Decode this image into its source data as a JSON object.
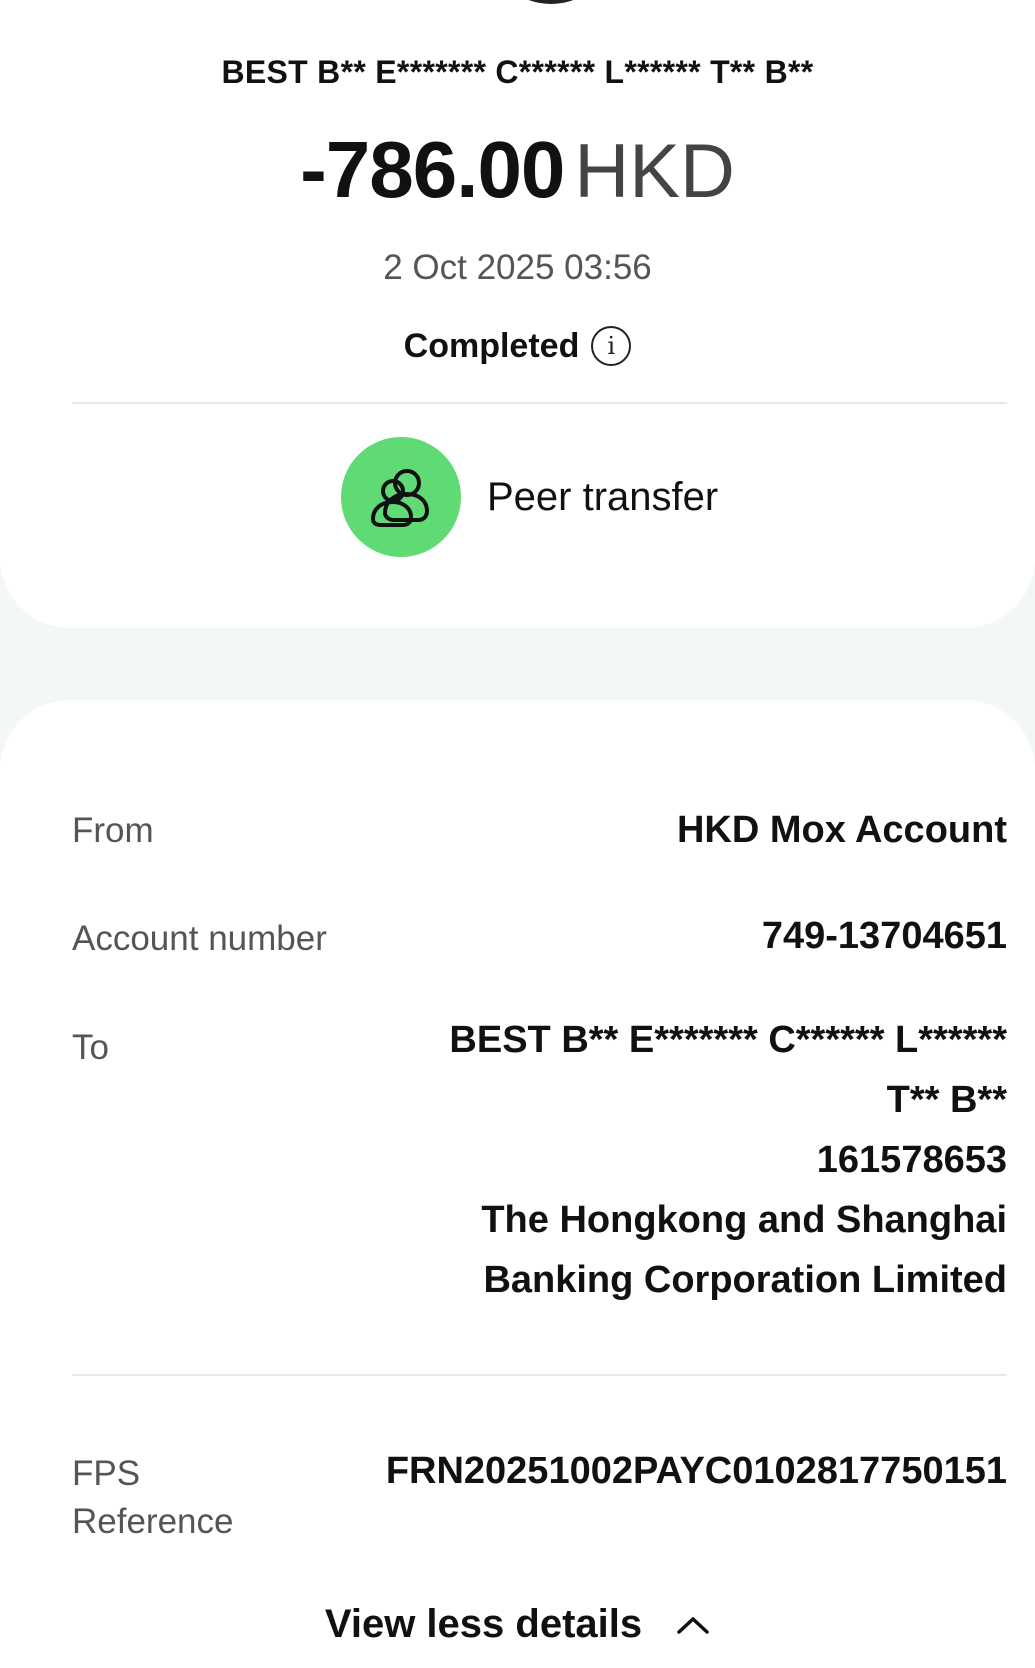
{
  "header": {
    "counterparty": "BEST B** E******* C****** L****** T** B**",
    "amount_value": "-786.00",
    "amount_currency": "HKD",
    "datetime": "2 Oct 2025 03:56",
    "status": "Completed",
    "category_label": "Peer transfer",
    "category_color": "#5fda74"
  },
  "details": {
    "from_label": "From",
    "from_value": "HKD Mox Account",
    "account_label": "Account number",
    "account_value": "749-13704651",
    "to_label": "To",
    "to_lines": [
      "BEST B** E******* C****** L******",
      "T** B**",
      "161578653",
      "The Hongkong and Shanghai",
      "Banking Corporation Limited"
    ],
    "fps_label_line1": "FPS",
    "fps_label_line2": "Reference",
    "fps_value": "FRN20251002PAYC0102817750151"
  },
  "footer": {
    "view_less_label": "View less details",
    "icon": "chevron-up-icon"
  }
}
